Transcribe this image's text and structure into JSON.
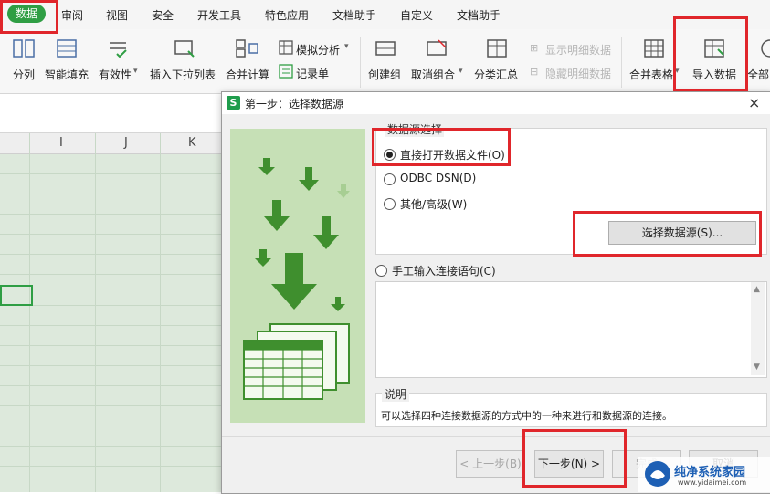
{
  "menu": {
    "items": [
      "数据",
      "审阅",
      "视图",
      "安全",
      "开发工具",
      "特色应用",
      "文档助手",
      "自定义",
      "文档助手"
    ]
  },
  "ribbon": {
    "buttons": [
      "分列",
      "智能填充",
      "有效性",
      "插入下拉列表",
      "合并计算",
      "模拟分析",
      "记录单",
      "创建组",
      "取消组合",
      "分类汇总",
      "显示明细数据",
      "隐藏明细数据",
      "合并表格",
      "导入数据",
      "全部"
    ]
  },
  "sheet": {
    "columns": [
      "I",
      "J",
      "K"
    ]
  },
  "dialog": {
    "title": "第一步：选择数据源",
    "logo": "S",
    "close": "×",
    "source_group_title": "数据源选择",
    "options": [
      "直接打开数据文件(O)",
      "ODBC DSN(D)",
      "其他/高级(W)"
    ],
    "selected_option": "直接打开数据文件(O)",
    "select_source_button": "选择数据源(S)...",
    "manual_option": "手工输入连接语句(C)",
    "desc_group_title": "说明",
    "desc_text": "可以选择四种连接数据源的方式中的一种来进行和数据源的连接。",
    "buttons": {
      "prev": "< 上一步(B)",
      "next": "下一步(N) >",
      "finish": "完成",
      "cancel": "取消"
    }
  },
  "watermark": {
    "name": "纯净系统家园",
    "url": "www.yidaimei.com"
  },
  "colors": {
    "accent": "#2f9e44",
    "highlight": "#e0262b",
    "sheet_bg": "#dde9dc",
    "illustration_bg": "#c6e0b6",
    "arrow_green": "#3f8f2e"
  }
}
